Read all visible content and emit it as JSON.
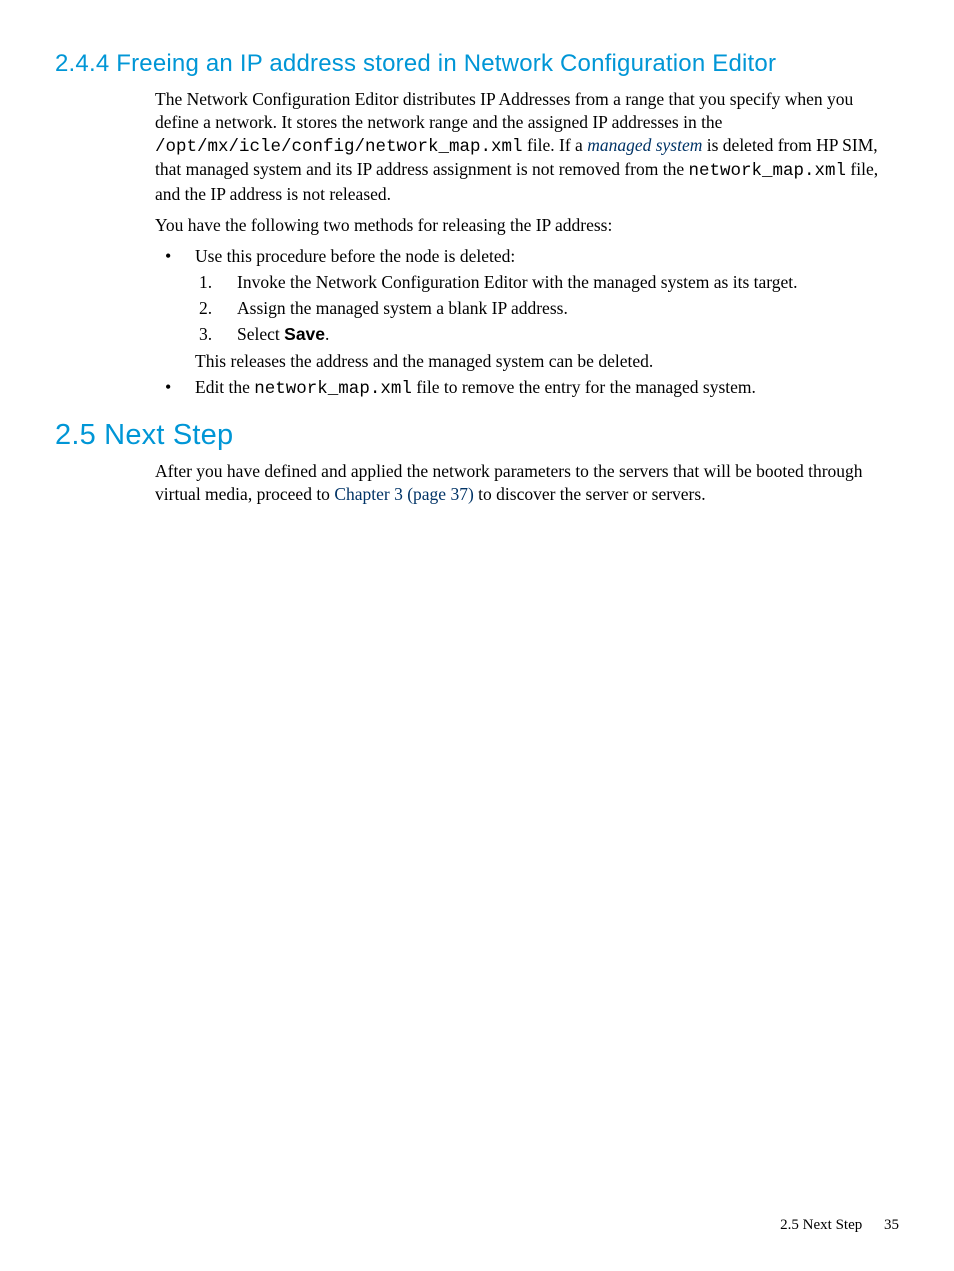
{
  "section244": {
    "heading": "2.4.4 Freeing an IP address stored in Network Configuration Editor",
    "p1a": "The Network Configuration Editor distributes IP Addresses from a range that you specify when you define a network. It stores the network range and the assigned IP addresses in the ",
    "code1": "/opt/mx/icle/config/network_map.xml",
    "p1b": " file. If a ",
    "link1": "managed system",
    "p1c": " is deleted from HP SIM, that managed system and its IP address assignment is not removed from the ",
    "code2": "network_map.xml",
    "p1d": " file, and the IP address is not released.",
    "p2": "You have the following two methods for releasing the IP address:",
    "bullet1_intro": "Use this procedure before the node is deleted:",
    "step1_num": "1.",
    "step1": "Invoke the Network Configuration Editor with the managed system as its target.",
    "step2_num": "2.",
    "step2": "Assign the managed system a blank IP address.",
    "step3_num": "3.",
    "step3_pre": "Select ",
    "step3_bold": "Save",
    "step3_post": ".",
    "bullet1_outro": "This releases the address and the managed system can be deleted.",
    "bullet2_pre": "Edit the ",
    "bullet2_code": "network_map.xml",
    "bullet2_post": " file to remove the entry for the managed system."
  },
  "section25": {
    "heading": "2.5 Next Step",
    "p1a": "After you have defined and applied the network parameters to the servers that will be booted through virtual media, proceed to ",
    "link": "Chapter 3 (page 37)",
    "p1b": " to discover the server or servers."
  },
  "footer": {
    "label": "2.5 Next Step",
    "page": "35"
  }
}
